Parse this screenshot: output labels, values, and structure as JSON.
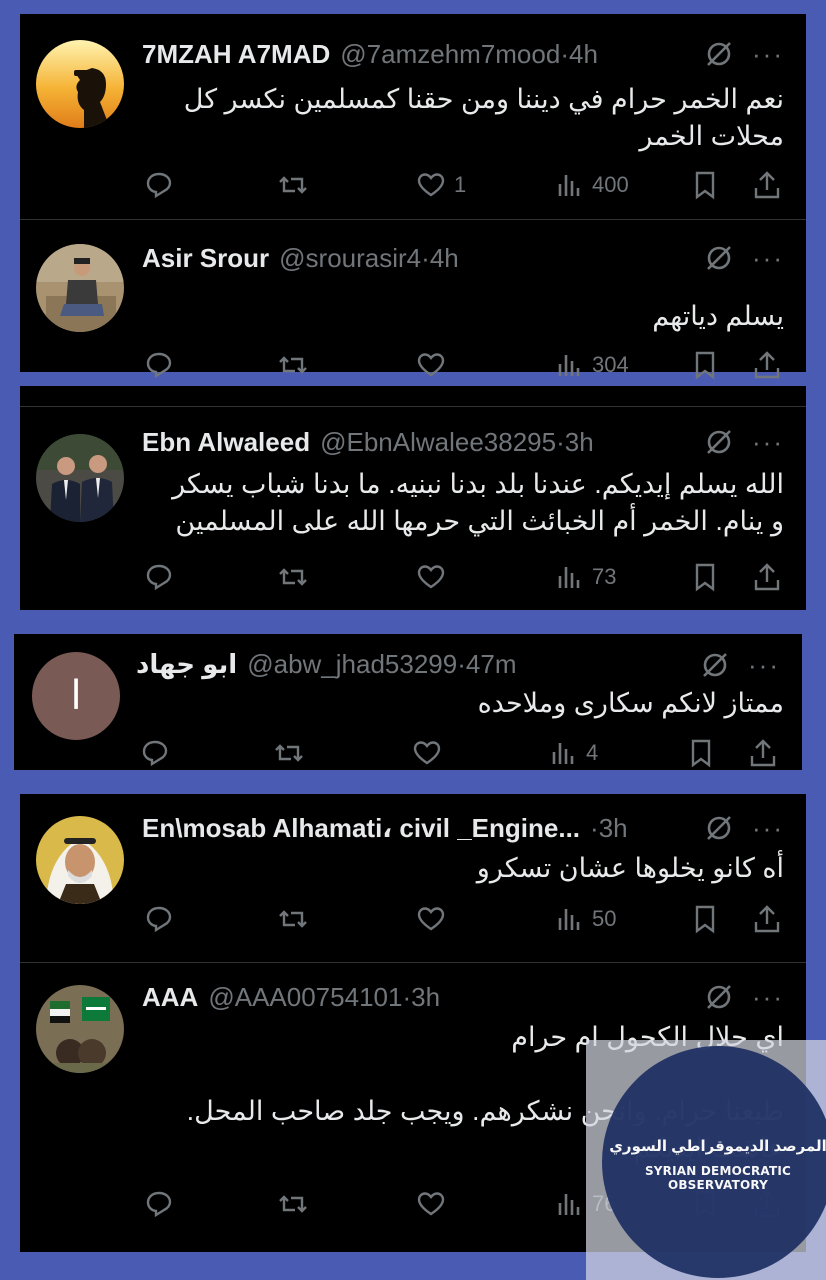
{
  "tweets": [
    {
      "name": "7MZAH A7MAD",
      "handle": "@7amzehm7mood",
      "time": "4h",
      "text": "نعم الخمر حرام في ديننا ومن حقنا كمسلمين نكسر كل\nمحلات الخمر",
      "likes": "1",
      "views": "400"
    },
    {
      "name": "Asir Srour",
      "handle": "@srourasir4",
      "time": "4h",
      "text": "يسلم دياتهم",
      "likes": "",
      "views": "304"
    },
    {
      "name": "Ebn Alwaleed",
      "handle": "@EbnAlwalee38295",
      "time": "3h",
      "text": "الله يسلم إيديكم. عندنا بلد بدنا نبنيه. ما بدنا شباب يسكر\nو ينام. الخمر أم الخبائث التي حرمها الله على المسلمين",
      "likes": "",
      "views": "73"
    },
    {
      "name": "ابو جهاد",
      "handle": "@abw_jhad53299",
      "time": "47m",
      "avatar_letter": "ا",
      "text": "ممتاز  لانكم سكارى وملاحده",
      "likes": "",
      "views": "4"
    },
    {
      "name": "En\\mosab Alhamati، civil _Engine...",
      "handle": "",
      "time": "3h",
      "text": "أه كانو يخلوها عشان تسكرو",
      "likes": "",
      "views": "50"
    },
    {
      "name": "AAA",
      "handle": "@AAA00754101",
      "time": "3h",
      "text": "اي حلال الكحول ام حرام\n\nطبعنا حرام. وانحن نشكرهم. ويجب جلد صاحب المحل.\nعاشت ايديكم",
      "likes": "",
      "views": "76"
    }
  ],
  "more_glyph": "···",
  "dot": "·",
  "watermark": {
    "arabic": "المرصد الديموقراطي السوري",
    "english": "SYRIAN DEMOCRATIC OBSERVATORY"
  },
  "colors": {
    "background": "#4a5bb4",
    "card": "#000000",
    "text": "#e7e9ea",
    "muted": "#71767b",
    "divider": "#2f3336"
  }
}
